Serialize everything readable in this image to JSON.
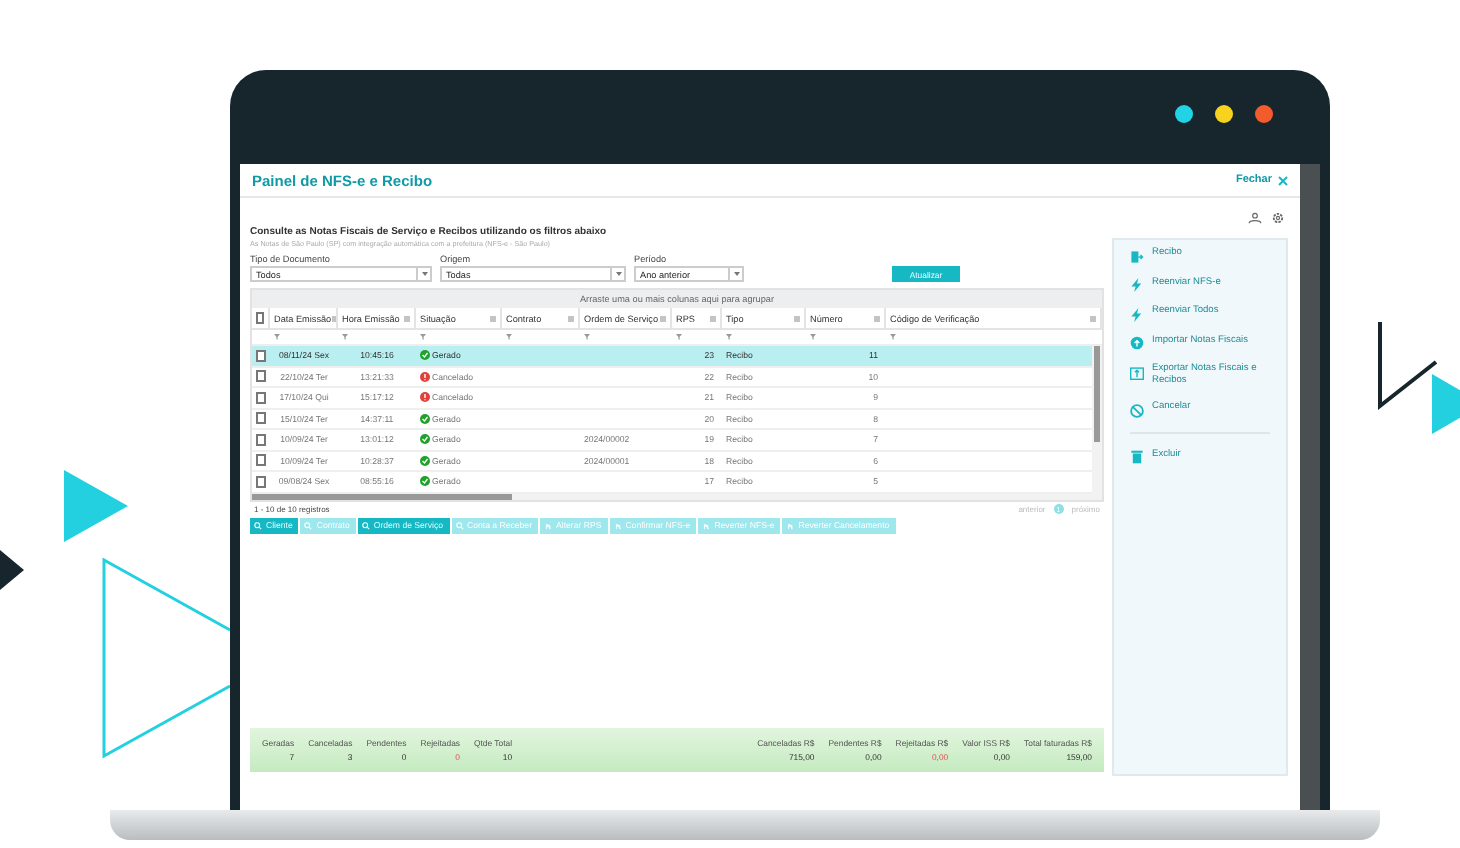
{
  "window": {
    "title": "Painel de NFS-e e Recibo",
    "close_label": "Fechar"
  },
  "intro": {
    "heading": "Consulte as Notas Fiscais de Serviço e Recibos utilizando os filtros abaixo",
    "note": "As Notas de São Paulo (SP) com integração automática com a prefeitura (NFS-e - São Paulo)"
  },
  "filters": [
    {
      "label": "Tipo de Documento",
      "value": "Todos"
    },
    {
      "label": "Origem",
      "value": "Todas"
    },
    {
      "label": "Período",
      "value": "Ano anterior"
    }
  ],
  "refresh_button": "Atualizar",
  "group_hint": "Arraste uma ou mais colunas aqui para agrupar",
  "table": {
    "all_checked": false,
    "columns": [
      "Data Emissão",
      "Hora Emissão",
      "Situação",
      "Contrato",
      "Ordem de Serviço",
      "RPS",
      "Tipo",
      "Número",
      "Código de Verificação"
    ],
    "rows": [
      {
        "selected": true,
        "checked": false,
        "kind": "ok",
        "cells": [
          "08/11/24 Sex",
          "10:45:16",
          "Gerado",
          "",
          "",
          "23",
          "Recibo",
          "11",
          ""
        ]
      },
      {
        "selected": false,
        "checked": false,
        "kind": "cancelled",
        "cells": [
          "22/10/24 Ter",
          "13:21:33",
          "Cancelado",
          "",
          "",
          "22",
          "Recibo",
          "10",
          ""
        ]
      },
      {
        "selected": false,
        "checked": false,
        "kind": "cancelled",
        "cells": [
          "17/10/24 Qui",
          "15:17:12",
          "Cancelado",
          "",
          "",
          "21",
          "Recibo",
          "9",
          ""
        ]
      },
      {
        "selected": false,
        "checked": false,
        "kind": "ok",
        "cells": [
          "15/10/24 Ter",
          "14:37:11",
          "Gerado",
          "",
          "",
          "20",
          "Recibo",
          "8",
          ""
        ]
      },
      {
        "selected": false,
        "checked": false,
        "kind": "ok",
        "cells": [
          "10/09/24 Ter",
          "13:01:12",
          "Gerado",
          "",
          "2024/00002",
          "19",
          "Recibo",
          "7",
          ""
        ]
      },
      {
        "selected": false,
        "checked": false,
        "kind": "ok",
        "cells": [
          "10/09/24 Ter",
          "10:28:37",
          "Gerado",
          "",
          "2024/00001",
          "18",
          "Recibo",
          "6",
          ""
        ]
      },
      {
        "selected": false,
        "checked": false,
        "kind": "ok",
        "cells": [
          "09/08/24 Sex",
          "08:55:16",
          "Gerado",
          "",
          "",
          "17",
          "Recibo",
          "5",
          ""
        ]
      }
    ]
  },
  "pagination": {
    "summary": "1 - 10 de 10 registros",
    "previous": "anterior",
    "page": "1",
    "next": "próximo"
  },
  "buttons": [
    {
      "label": "Cliente",
      "selected": true,
      "kind": "search"
    },
    {
      "label": "Contrato",
      "selected": false,
      "kind": "search"
    },
    {
      "label": "Ordem de Serviço",
      "selected": true,
      "kind": "search"
    },
    {
      "label": "Conta a Receber",
      "selected": false,
      "kind": "search"
    },
    {
      "label": "Alterar RPS",
      "selected": false,
      "kind": "hand"
    },
    {
      "label": "Confirmar NFS-e",
      "selected": false,
      "kind": "hand"
    },
    {
      "label": "Reverter NFS-e",
      "selected": false,
      "kind": "hand"
    },
    {
      "label": "Reverter Cancelamento",
      "selected": false,
      "kind": "hand"
    }
  ],
  "summary": {
    "counts": [
      {
        "label": "Geradas",
        "value": "7",
        "alert": false
      },
      {
        "label": "Canceladas",
        "value": "3",
        "alert": false
      },
      {
        "label": "Pendentes",
        "value": "0",
        "alert": false
      },
      {
        "label": "Rejeitadas",
        "value": "0",
        "alert": true
      },
      {
        "label": "Qtde Total",
        "value": "10",
        "alert": false
      }
    ],
    "totals": [
      {
        "label": "Canceladas R$",
        "value": "715,00",
        "alert": false
      },
      {
        "label": "Pendentes R$",
        "value": "0,00",
        "alert": false
      },
      {
        "label": "Rejeitadas R$",
        "value": "0,00",
        "alert": true
      },
      {
        "label": "Valor ISS R$",
        "value": "0,00",
        "alert": false
      },
      {
        "label": "Total faturadas R$",
        "value": "159,00",
        "alert": false
      }
    ]
  },
  "sidebar": {
    "actions": [
      {
        "label": "Recibo",
        "kind": "receipt"
      },
      {
        "label": "Reenviar NFS-e",
        "kind": "bolt"
      },
      {
        "label": "Reenviar Todos",
        "kind": "bolt"
      },
      {
        "label": "Importar Notas Fiscais",
        "kind": "upload"
      },
      {
        "label": "Exportar Notas Fiscais e Recibos",
        "kind": "export"
      },
      {
        "label": "Cancelar",
        "kind": "cancel"
      }
    ],
    "footer_actions": [
      {
        "label": "Excluir",
        "kind": "trash"
      }
    ]
  }
}
